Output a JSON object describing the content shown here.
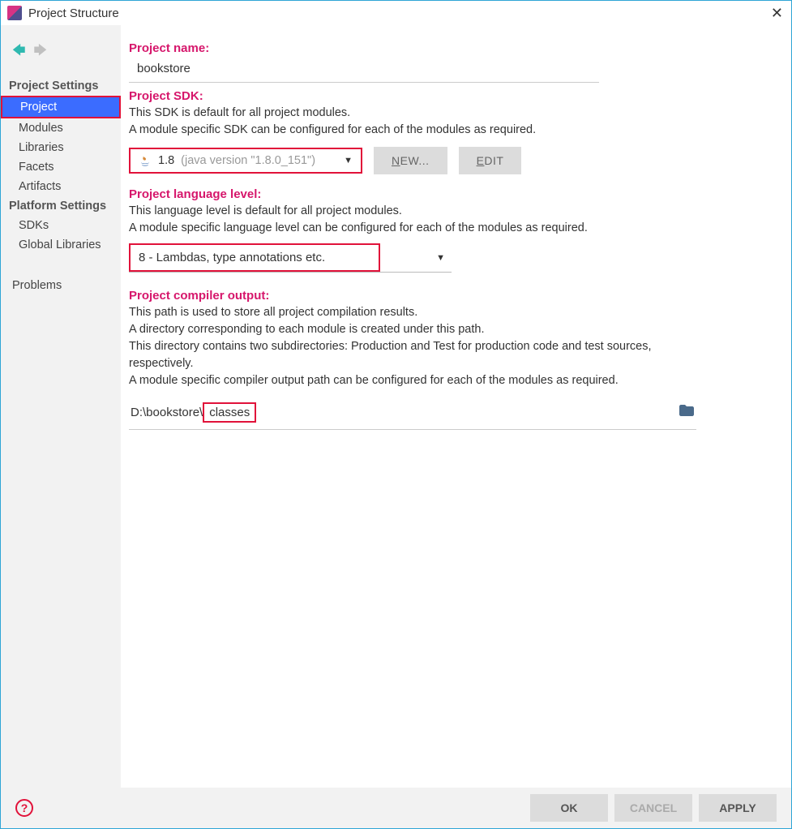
{
  "window": {
    "title": "Project Structure"
  },
  "sidebar": {
    "head1": "Project Settings",
    "head2": "Platform Settings",
    "items1": [
      "Project",
      "Modules",
      "Libraries",
      "Facets",
      "Artifacts"
    ],
    "items2": [
      "SDKs",
      "Global Libraries"
    ],
    "problems": "Problems"
  },
  "project": {
    "name_label": "Project name:",
    "name_value": "bookstore",
    "sdk_label": "Project SDK:",
    "sdk_desc1": "This SDK is default for all project modules.",
    "sdk_desc2": "A module specific SDK can be configured for each of the modules as required.",
    "sdk_value_main": "1.8",
    "sdk_value_grey": "(java version \"1.8.0_151\")",
    "btn_new_pre": "N",
    "btn_new_rest": "EW...",
    "btn_edit_pre": "E",
    "btn_edit_rest": "DIT",
    "lang_label": "Project language level:",
    "lang_desc1": "This language level is default for all project modules.",
    "lang_desc2": "A module specific language level can be configured for each of the modules as required.",
    "lang_value": "8 - Lambdas, type annotations etc.",
    "out_label": "Project compiler output:",
    "out_desc1": "This path is used to store all project compilation results.",
    "out_desc2": "A directory corresponding to each module is created under this path.",
    "out_desc3": "This directory contains two subdirectories: Production and Test for production code and test sources, respectively.",
    "out_desc4": "A module specific compiler output path can be configured for each of the modules as required.",
    "out_path_pre": "D:\\bookstore\\",
    "out_path_hl": "classes"
  },
  "footer": {
    "ok": "OK",
    "cancel": "CANCEL",
    "apply": "APPLY"
  }
}
